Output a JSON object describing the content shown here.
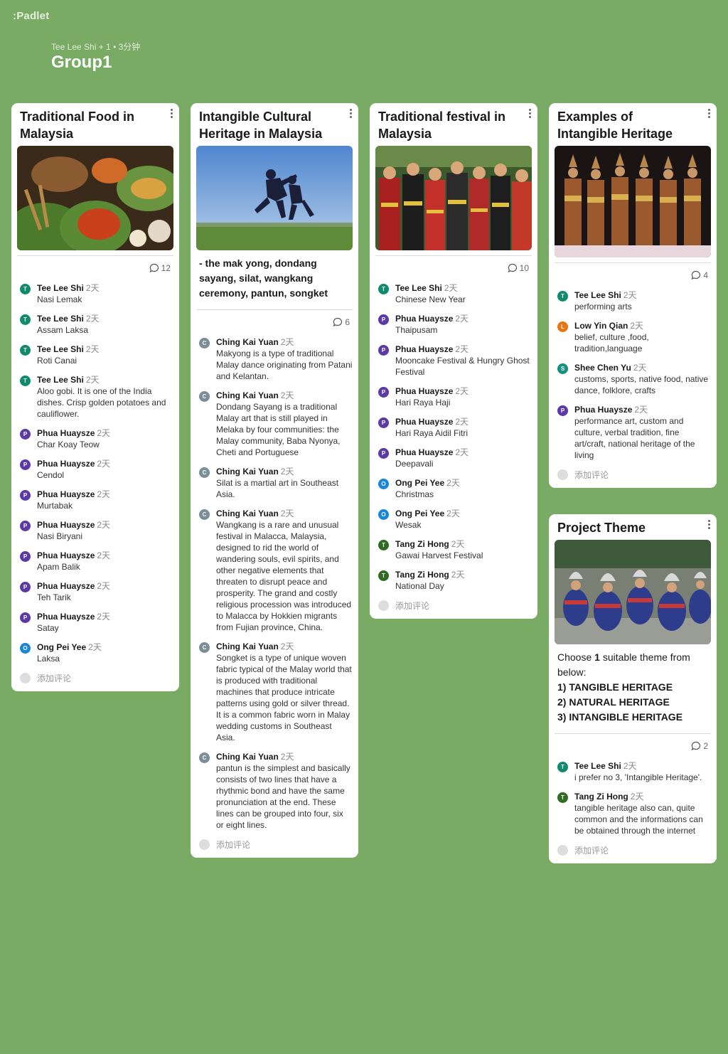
{
  "app": {
    "logo": ":Padlet",
    "meta": "Tee Lee Shi + 1 • 3分钟",
    "title": "Group1"
  },
  "add_comment_label": "添加评论",
  "avatar_colors": {
    "T": "#0f8a6a",
    "P": "#5b3aa6",
    "C": "#7b8d96",
    "O": "#1a86d6",
    "L": "#e87512",
    "S": "#13907e",
    "TZ": "#2f6b22"
  },
  "cards": [
    {
      "title": "Traditional Food in Malaysia",
      "image": "food-photo",
      "count": "12",
      "comments": [
        {
          "initial": "T",
          "name": "Tee Lee Shi",
          "time": "2天",
          "text": "Nasi Lemak"
        },
        {
          "initial": "T",
          "name": "Tee Lee Shi",
          "time": "2天",
          "text": "Assam Laksa"
        },
        {
          "initial": "T",
          "name": "Tee Lee Shi",
          "time": "2天",
          "text": "Roti Canai"
        },
        {
          "initial": "T",
          "name": "Tee Lee Shi",
          "time": "2天",
          "text": "Aloo gobi. It is one of the India dishes. Crisp golden potatoes and cauliflower."
        },
        {
          "initial": "P",
          "name": "Phua Huaysze",
          "time": "2天",
          "text": "Char Koay Teow"
        },
        {
          "initial": "P",
          "name": "Phua Huaysze",
          "time": "2天",
          "text": "Cendol"
        },
        {
          "initial": "P",
          "name": "Phua Huaysze",
          "time": "2天",
          "text": "Murtabak"
        },
        {
          "initial": "P",
          "name": "Phua Huaysze",
          "time": "2天",
          "text": "Nasi Biryani"
        },
        {
          "initial": "P",
          "name": "Phua Huaysze",
          "time": "2天",
          "text": "Apam Balik"
        },
        {
          "initial": "P",
          "name": "Phua Huaysze",
          "time": "2天",
          "text": "Teh Tarik"
        },
        {
          "initial": "P",
          "name": "Phua Huaysze",
          "time": "2天",
          "text": "Satay"
        },
        {
          "initial": "O",
          "name": "Ong Pei Yee",
          "time": "2天",
          "text": "Laksa"
        }
      ]
    },
    {
      "title": "Intangible Cultural Heritage in Malaysia",
      "image": "silat-photo",
      "body": "- the mak yong, dondang sayang, silat, wangkang ceremony, pantun, songket",
      "count": "6",
      "comments": [
        {
          "initial": "C",
          "name": "Ching Kai Yuan",
          "time": "2天",
          "text": "Makyong is a type of traditional Malay dance originating from Patani and Kelantan."
        },
        {
          "initial": "C",
          "name": "Ching Kai Yuan",
          "time": "2天",
          "text": "Dondang Sayang is a traditional Malay art that is still played in Melaka by four communities: the Malay community, Baba Nyonya, Cheti and Portuguese"
        },
        {
          "initial": "C",
          "name": "Ching Kai Yuan",
          "time": "2天",
          "text": "Silat is a martial art in Southeast Asia."
        },
        {
          "initial": "C",
          "name": "Ching Kai Yuan",
          "time": "2天",
          "text": "Wangkang is a rare and unusual festival in Malacca, Malaysia, designed to rid the world of wandering souls, evil spirits, and other negative elements that threaten to disrupt peace and prosperity. The grand and costly religious procession was introduced to Malacca by Hokkien migrants from Fujian province, China."
        },
        {
          "initial": "C",
          "name": "Ching Kai Yuan",
          "time": "2天",
          "text": "Songket is a type of unique woven fabric typical of the Malay world that is produced with traditional machines that produce intricate patterns using gold or silver thread. It is a common fabric worn in Malay wedding customs in Southeast Asia."
        },
        {
          "initial": "C",
          "name": "Ching Kai Yuan",
          "time": "2天",
          "text": "pantun is the simplest and basically consists of two lines that have a rhythmic bond and have the same pronunciation at the end. These lines can be grouped into four, six or eight lines."
        }
      ]
    },
    {
      "title": "Traditional festival in Malaysia",
      "image": "festival-photo",
      "count": "10",
      "comments": [
        {
          "initial": "T",
          "name": "Tee Lee Shi",
          "time": "2天",
          "text": "Chinese New Year"
        },
        {
          "initial": "P",
          "name": "Phua Huaysze",
          "time": "2天",
          "text": "Thaipusam"
        },
        {
          "initial": "P",
          "name": "Phua Huaysze",
          "time": "2天",
          "text": "Mooncake Festival & Hungry Ghost Festival"
        },
        {
          "initial": "P",
          "name": "Phua Huaysze",
          "time": "2天",
          "text": "Hari Raya Haji"
        },
        {
          "initial": "P",
          "name": "Phua Huaysze",
          "time": "2天",
          "text": "Hari Raya Aidil Fitri"
        },
        {
          "initial": "P",
          "name": "Phua Huaysze",
          "time": "2天",
          "text": "Deepavali"
        },
        {
          "initial": "O",
          "name": "Ong Pei Yee",
          "time": "2天",
          "text": "Christmas"
        },
        {
          "initial": "O",
          "name": "Ong Pei Yee",
          "time": "2天",
          "text": "Wesak"
        },
        {
          "initial": "TZ",
          "name": "Tang Zi Hong",
          "time": "2天",
          "text": "Gawai Harvest Festival"
        },
        {
          "initial": "TZ",
          "name": "Tang Zi Hong",
          "time": "2天",
          "text": "National Day"
        }
      ]
    },
    {
      "title": "Examples of Intangible Heritage",
      "image": "dancers-photo",
      "count": "4",
      "comments": [
        {
          "initial": "T",
          "name": "Tee Lee Shi",
          "time": "2天",
          "text": "performing arts"
        },
        {
          "initial": "L",
          "name": "Low Yin Qian",
          "time": "2天",
          "text": "belief, culture ,food, tradition,language"
        },
        {
          "initial": "S",
          "name": "Shee Chen Yu",
          "time": "2天",
          "text": "customs, sports, native food, native dance, folklore, crafts"
        },
        {
          "initial": "P",
          "name": "Phua Huaysze",
          "time": "2天",
          "text": "performance art, custom and culture, verbal tradition, fine art/craft, national heritage of the living"
        }
      ]
    },
    {
      "title": "Project Theme",
      "image": "parade-photo",
      "body_lines": [
        "Choose ",
        "1",
        " suitable theme from below:"
      ],
      "themes": [
        "1) TANGIBLE HERITAGE",
        "2) NATURAL HERITAGE",
        "3) INTANGIBLE HERITAGE"
      ],
      "count": "2",
      "comments": [
        {
          "initial": "T",
          "name": "Tee Lee Shi",
          "time": "2天",
          "text": "i prefer no 3, 'Intangible Heritage'."
        },
        {
          "initial": "TZ",
          "name": "Tang Zi Hong",
          "time": "2天",
          "text": "tangible heritage also can, quite common and the informations can be obtained through the internet"
        }
      ]
    }
  ]
}
